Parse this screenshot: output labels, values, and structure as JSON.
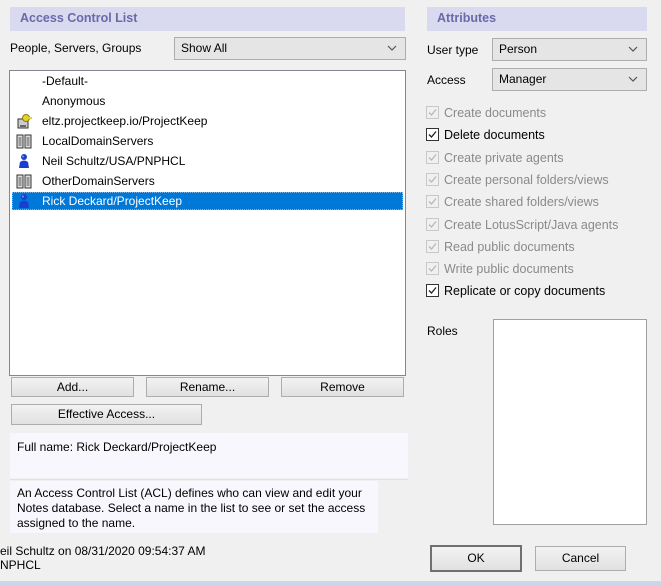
{
  "acl": {
    "header": "Access Control List",
    "filter_label": "People, Servers, Groups",
    "filter_value": "Show All",
    "entries": [
      {
        "name": "-Default-",
        "icon": "none"
      },
      {
        "name": "Anonymous",
        "icon": "none"
      },
      {
        "name": "eltz.projectkeep.io/ProjectKeep",
        "icon": "server-key-icon"
      },
      {
        "name": "LocalDomainServers",
        "icon": "server-group-icon"
      },
      {
        "name": "Neil Schultz/USA/PNPHCL",
        "icon": "person-icon"
      },
      {
        "name": "OtherDomainServers",
        "icon": "server-group-icon"
      },
      {
        "name": "Rick Deckard/ProjectKeep",
        "icon": "person-icon",
        "selected": true
      }
    ],
    "buttons": {
      "add": "Add...",
      "rename": "Rename...",
      "remove": "Remove",
      "effective_access": "Effective Access..."
    },
    "full_name": "Full name: Rick Deckard/ProjectKeep",
    "description": "An Access Control List (ACL) defines who can view and edit your Notes database.  Select a name in the list to see or set the access assigned to the name."
  },
  "attributes": {
    "header": "Attributes",
    "user_type_label": "User type",
    "user_type_value": "Person",
    "access_label": "Access",
    "access_value": "Manager",
    "permissions": [
      {
        "label": "Create documents",
        "checked": true,
        "enabled": false
      },
      {
        "label": "Delete documents",
        "checked": true,
        "enabled": true
      },
      {
        "label": "Create private agents",
        "checked": true,
        "enabled": false
      },
      {
        "label": "Create personal folders/views",
        "checked": true,
        "enabled": false
      },
      {
        "label": "Create shared folders/views",
        "checked": true,
        "enabled": false
      },
      {
        "label": "Create LotusScript/Java agents",
        "checked": true,
        "enabled": false
      },
      {
        "label": "Read public documents",
        "checked": true,
        "enabled": false
      },
      {
        "label": "Write public documents",
        "checked": true,
        "enabled": false
      },
      {
        "label": "Replicate or copy documents",
        "checked": true,
        "enabled": true
      }
    ],
    "roles_label": "Roles",
    "roles": []
  },
  "footer": {
    "modified_line1": "eil Schultz on 08/31/2020 09:54:37 AM",
    "modified_line2": "NPHCL",
    "ok": "OK",
    "cancel": "Cancel"
  }
}
